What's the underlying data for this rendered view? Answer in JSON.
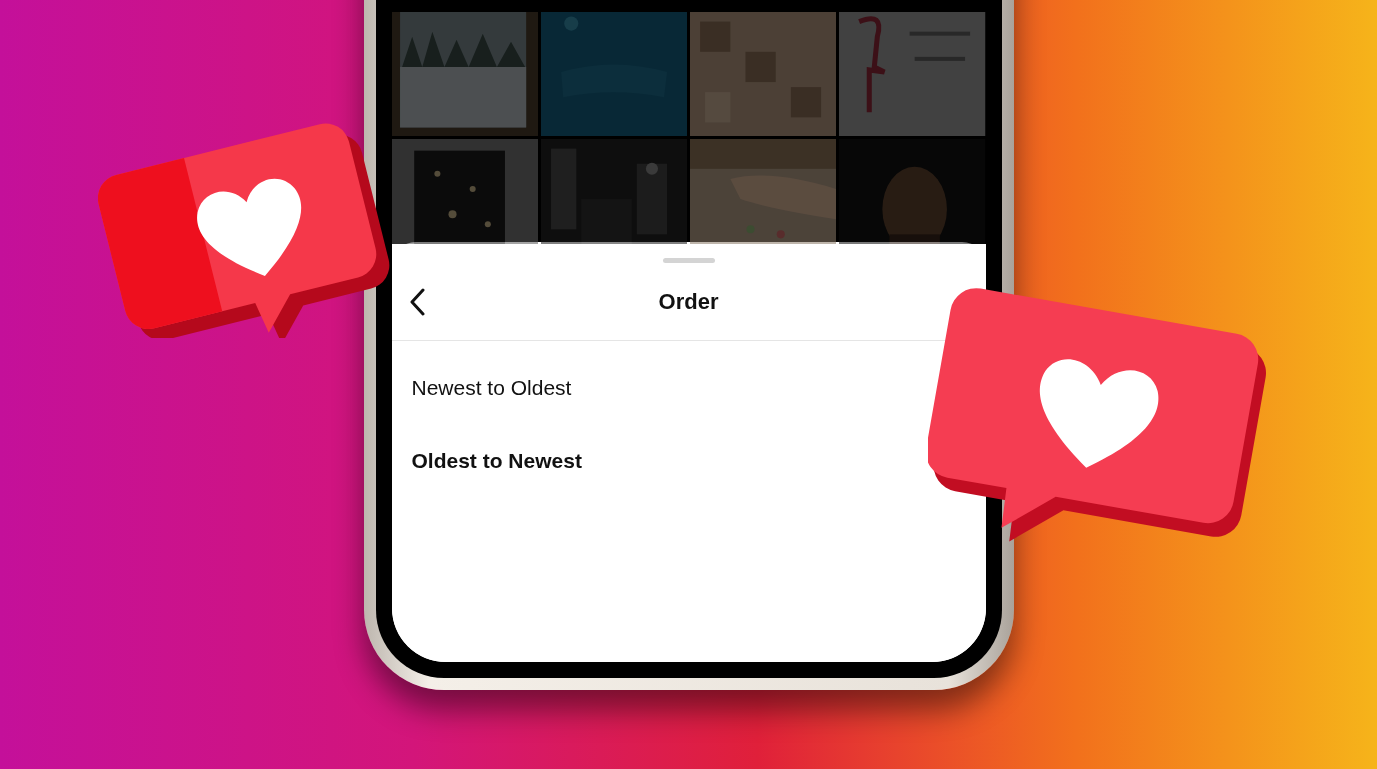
{
  "sheet": {
    "title": "Order",
    "options": [
      {
        "label": "Newest to Oldest",
        "selected": false
      },
      {
        "label": "Oldest to Newest",
        "selected": true
      }
    ]
  }
}
